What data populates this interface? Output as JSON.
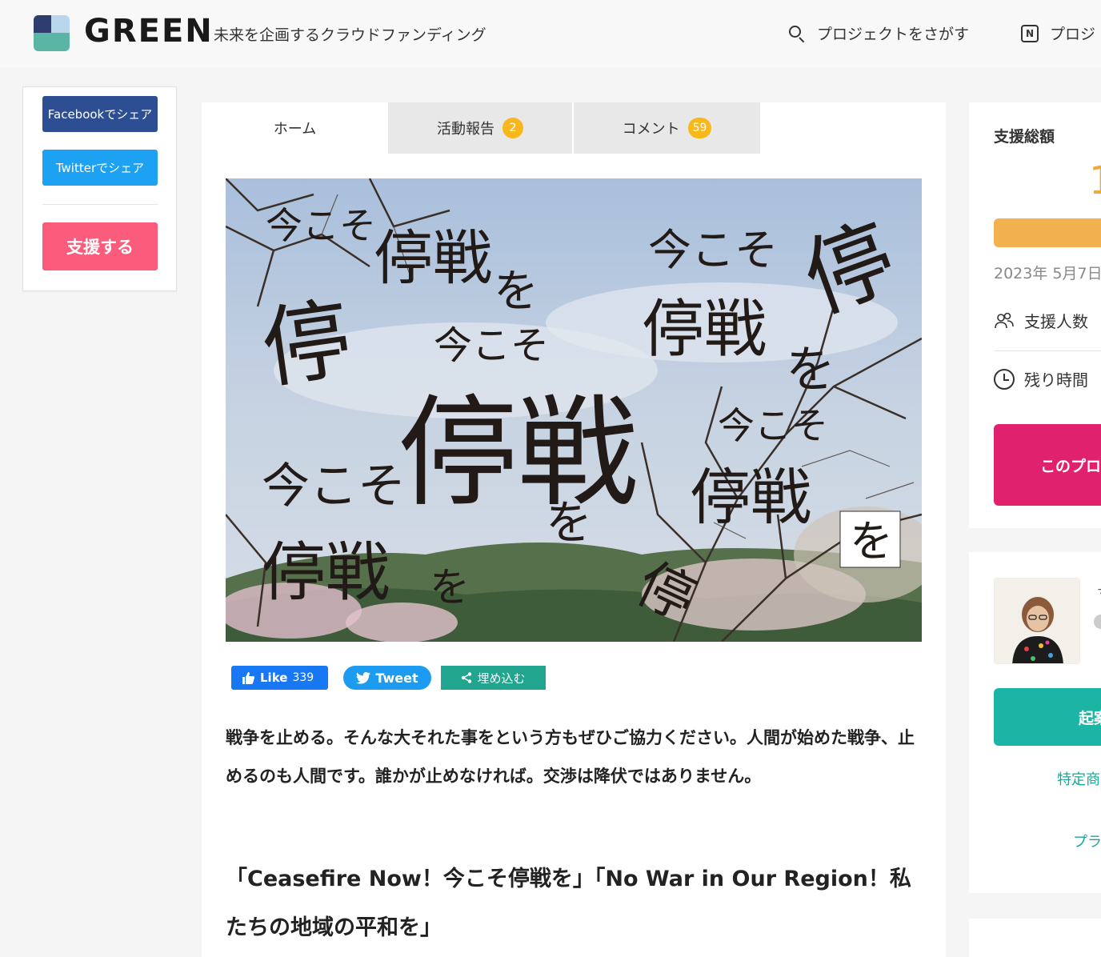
{
  "header": {
    "logo_text": "GREEN",
    "tagline": "未来を企画するクラウドファンディング",
    "search_label": "プロジェクトをさがす",
    "new_label": "プロジ"
  },
  "share": {
    "facebook": "Facebookでシェア",
    "twitter": "Twitterでシェア",
    "support": "支援する"
  },
  "tabs": [
    {
      "label": "ホーム"
    },
    {
      "label": "活動報告",
      "badge": "2"
    },
    {
      "label": "コメント",
      "badge": "59"
    }
  ],
  "hero": {
    "texts": [
      "今こそ",
      "停戦",
      "を",
      "停"
    ]
  },
  "social": {
    "like_label": "Like",
    "like_count": "339",
    "tweet_label": "Tweet",
    "embed_label": "埋め込む"
  },
  "content": {
    "lead": "戦争を止める。そんな大それた事をという方もぜひご協力ください。人間が始めた戦争、止めるのも人間です。誰かが止めなければ。交渉は降伏ではありません。",
    "subhead": "「Ceasefire  Now！今こそ停戦を」「No War in Our Region！私たちの地域の平和を」"
  },
  "sidebar": {
    "total_label": "支援総額",
    "amount_fragment": "1",
    "date_fragment": "2023年 5月7日",
    "supporters_label": "支援人数",
    "time_label": "残り時間",
    "project_button_fragment": "このプロ",
    "owner_name_fragment": "マ",
    "owner_button_fragment": "起案",
    "link1_fragment": "特定商",
    "link2_fragment": "プラ"
  },
  "colors": {
    "support_pink": "#fb5c7c",
    "facebook_blue": "#2d4e92",
    "twitter_blue": "#1da1f2",
    "amount_orange": "#f2a93b",
    "project_magenta": "#e0226e",
    "owner_teal": "#1cb4a4"
  }
}
